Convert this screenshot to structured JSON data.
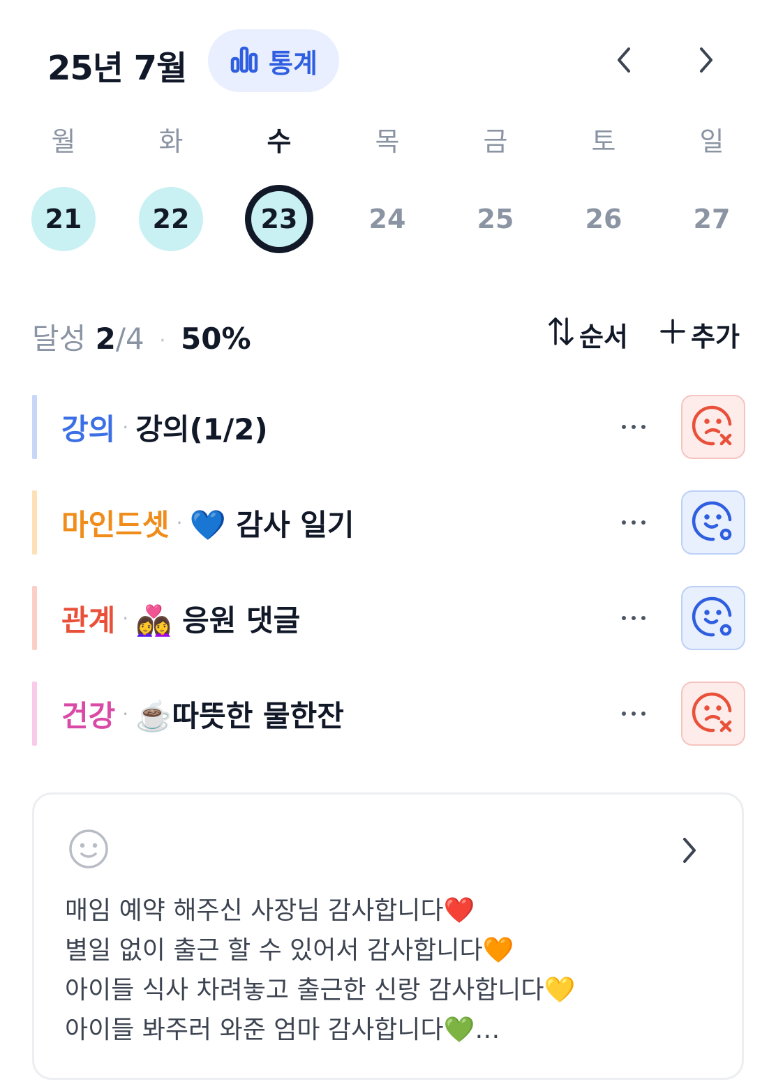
{
  "header": {
    "month_title": "25년 7월",
    "stats_label": "통계"
  },
  "week": {
    "days": [
      {
        "weekday": "월",
        "date": "21",
        "state": "done"
      },
      {
        "weekday": "화",
        "date": "22",
        "state": "done"
      },
      {
        "weekday": "수",
        "date": "23",
        "state": "today"
      },
      {
        "weekday": "목",
        "date": "24",
        "state": "future"
      },
      {
        "weekday": "금",
        "date": "25",
        "state": "future"
      },
      {
        "weekday": "토",
        "date": "26",
        "state": "future"
      },
      {
        "weekday": "일",
        "date": "27",
        "state": "future"
      }
    ]
  },
  "progress": {
    "label": "달성",
    "done": "2",
    "total": "/4",
    "percent": "50%",
    "sort_label": "순서",
    "add_label": "추가"
  },
  "habits": [
    {
      "category": "강의",
      "category_color": "#3b6fe6",
      "bar_color": "#c8d6f7",
      "name": "강의(1/2)",
      "status": "fail"
    },
    {
      "category": "마인드셋",
      "category_color": "#f08c1a",
      "bar_color": "#fde0b8",
      "name": "💙 감사 일기",
      "status": "ok"
    },
    {
      "category": "관계",
      "category_color": "#e9503a",
      "bar_color": "#fbcfc6",
      "name": "👩‍❤️‍👩 응원 댓글",
      "status": "ok"
    },
    {
      "category": "건강",
      "category_color": "#d94aa6",
      "bar_color": "#f9cbe8",
      "name": "☕️따뜻한 물한잔",
      "status": "fail"
    }
  ],
  "memo": {
    "lines": [
      "매임 예약 해주신 사장님 감사합니다❤️",
      "별일 없이 출근 할 수 있어서 감사합니다🧡",
      "아이들 식사 차려놓고 출근한 신랑 감사합니다💛",
      "아이들 봐주러 와준 엄마 감사합니다💚…"
    ]
  },
  "colors": {
    "accent": "#2f5fe0",
    "done_circle": "#c9f0f2",
    "fail": "#e9503a",
    "ok": "#2f5fe0"
  },
  "icons": {
    "stats": "bar-chart-icon",
    "prev": "chevron-left-icon",
    "next": "chevron-right-icon",
    "sort": "sort-arrows-icon",
    "add": "plus-icon",
    "fail": "sad-face-x-icon",
    "ok": "smile-face-circle-icon",
    "mood": "smile-icon"
  }
}
